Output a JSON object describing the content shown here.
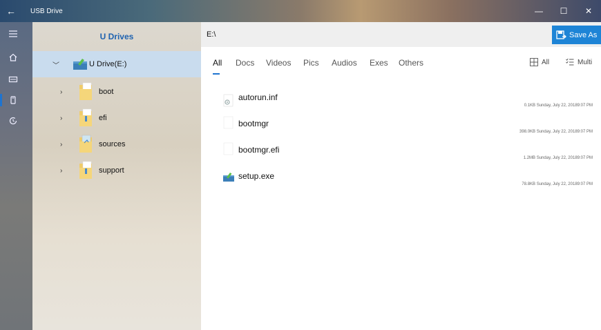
{
  "window": {
    "title": "USB Drive",
    "controls": {
      "minimize": "—",
      "maximize": "☐",
      "close": "✕"
    }
  },
  "rail": {
    "items": [
      "menu-icon",
      "home-icon",
      "storage-icon",
      "usb-icon",
      "history-icon"
    ]
  },
  "tree": {
    "header": "U Drives",
    "root": {
      "label": "U Drive(E:)",
      "expanded": true
    },
    "folders": [
      {
        "label": "boot"
      },
      {
        "label": "efi"
      },
      {
        "label": "sources"
      },
      {
        "label": "support"
      }
    ]
  },
  "path": {
    "value": "E:\\"
  },
  "save_as": {
    "label": "Save As"
  },
  "tabs": [
    {
      "label": "All",
      "active": true
    },
    {
      "label": "Docs"
    },
    {
      "label": "Videos"
    },
    {
      "label": "Pics"
    },
    {
      "label": "Audios"
    },
    {
      "label": "Exes"
    },
    {
      "label": "Others"
    }
  ],
  "tools": {
    "all_label": "All",
    "multi_label": "Multi"
  },
  "files": [
    {
      "name": "autorun.inf",
      "size": "0.1KB",
      "date": "Sunday, July 22, 20189:07 PM",
      "icon": "settings-file-icon"
    },
    {
      "name": "bootmgr",
      "size": "398.0KB",
      "date": "Sunday, July 22, 20189:07 PM",
      "icon": "blank-file-icon"
    },
    {
      "name": "bootmgr.efi",
      "size": "1.2MB",
      "date": "Sunday, July 22, 20189:07 PM",
      "icon": "blank-file-icon"
    },
    {
      "name": "setup.exe",
      "size": "78.8KB",
      "date": "Sunday, July 22, 20189:07 PM",
      "icon": "setup-icon"
    }
  ],
  "colors": {
    "accent": "#1e84d6",
    "selected_row": "#c9dcee",
    "header_text": "#1e62b0"
  }
}
